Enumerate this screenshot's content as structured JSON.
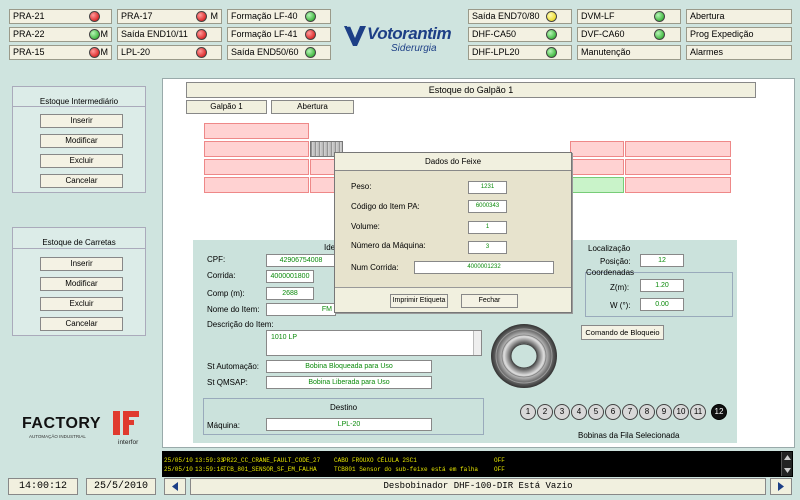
{
  "status": {
    "col1": [
      {
        "label": "PRA-21",
        "led": "red",
        "suffix": ""
      },
      {
        "label": "PRA-22",
        "led": "green",
        "suffix": "M"
      },
      {
        "label": "PRA-15",
        "led": "red",
        "suffix": "M"
      }
    ],
    "col2": [
      {
        "label": "PRA-17",
        "led": "red",
        "suffix": "M"
      },
      {
        "label": "Saída END10/11",
        "led": "red",
        "suffix": ""
      },
      {
        "label": "LPL-20",
        "led": "red",
        "suffix": ""
      }
    ],
    "col3": [
      {
        "label": "Formação LF-40",
        "led": "green"
      },
      {
        "label": "Formação LF-41",
        "led": "red"
      },
      {
        "label": "Saída END50/60",
        "led": "green"
      }
    ],
    "col4": [
      {
        "label": "Saída END70/80",
        "led": "yellow"
      },
      {
        "label": "DHF-CA50",
        "led": "green"
      },
      {
        "label": "DHF-LPL20",
        "led": "green"
      }
    ],
    "col5": [
      {
        "label": "DVM-LF",
        "led": "green"
      },
      {
        "label": "DVF-CA60",
        "led": "green"
      },
      {
        "label": "Manutenção",
        "led": ""
      }
    ],
    "col6": [
      "Abertura",
      "Prog Expedição",
      "Alarmes"
    ]
  },
  "brand": {
    "name": "Votorantim",
    "sub": "Siderurgia"
  },
  "est_inter": {
    "title": "Estoque Intermediário",
    "buttons": [
      "Inserir",
      "Modificar",
      "Excluir",
      "Cancelar"
    ]
  },
  "est_carr": {
    "title": "Estoque de Carretas",
    "buttons": [
      "Inserir",
      "Modificar",
      "Excluir",
      "Cancelar"
    ]
  },
  "factory": {
    "name": "FACTORY",
    "sub": "AUTOMAÇÃO INDUSTRIAL",
    "interfor": "interfor"
  },
  "main": {
    "title": "Estoque do Galpão 1",
    "tab_galpao": "Galpão 1",
    "tab_abertura": "Abertura"
  },
  "ident": {
    "title": "Ide",
    "cpf_label": "CPF:",
    "cpf": "42906754008",
    "corrida_label": "Corrida:",
    "corrida": "4000001800",
    "comp_label": "Comp (m):",
    "comp": "2688",
    "nome_label": "Nome do Item:",
    "nome": "FM",
    "desc_label": "Descrição do Item:",
    "desc": "1010 LP",
    "st_auto_label": "St Automação:",
    "st_auto": "Bobina Bloqueada para Uso",
    "st_qmsap_label": "St QMSAP:",
    "st_qmsap": "Bobina Liberada para Uso"
  },
  "destino": {
    "title": "Destino",
    "maquina_label": "Máquina:",
    "maquina": "LPL-20"
  },
  "local": {
    "title": "Localização",
    "posicao_label": "Posição:",
    "posicao": "12",
    "coord_title": "Coordenadas",
    "z_label": "Z(m):",
    "z": "1.20",
    "w_label": "W (°):",
    "w": "0.00",
    "bloqueio": "Comando de Bloqueio"
  },
  "dialog": {
    "title": "Dados do Feixe",
    "peso_label": "Peso:",
    "peso": "1231",
    "codigo_label": "Código do Item PA:",
    "codigo": "6000343",
    "volume_label": "Volume:",
    "volume": "1",
    "maquina_label": "Número da Máquina:",
    "maquina": "3",
    "corrida_label": "Num Corrida:",
    "corrida": "4000001232",
    "imprimir": "Imprimir Etiqueta",
    "fechar": "Fechar"
  },
  "fila": {
    "label": "Bobinas da Fila Selecionada",
    "nums": [
      "1",
      "2",
      "3",
      "4",
      "5",
      "6",
      "7",
      "8",
      "9",
      "10",
      "11",
      "12"
    ],
    "active": "12"
  },
  "alarms": [
    {
      "date": "25/05/10",
      "time": "13:59:33",
      "code": "PR22_CC_CRANE_FAULT_CODE_27",
      "desc": "CABO FROUXO CÉLULA 2SC1",
      "state": "OFF"
    },
    {
      "date": "25/05/10",
      "time": "13:59:16",
      "code": "TCB_801_SENSOR_SF_EM_FALHA",
      "desc": "TCB801 Sensor do sub-feixe está em falha",
      "state": "OFF"
    }
  ],
  "bottom": {
    "time": "14:00:12",
    "date": "25/5/2010",
    "message": "Desbobinador DHF-100-DIR Está Vazio"
  },
  "colors": {
    "bg": "#cfe4df",
    "panel": "#cbe2dc",
    "cell_red": "#ffd2d2",
    "cell_green": "#c9f3c9",
    "field_text": "#0a8a0a"
  }
}
